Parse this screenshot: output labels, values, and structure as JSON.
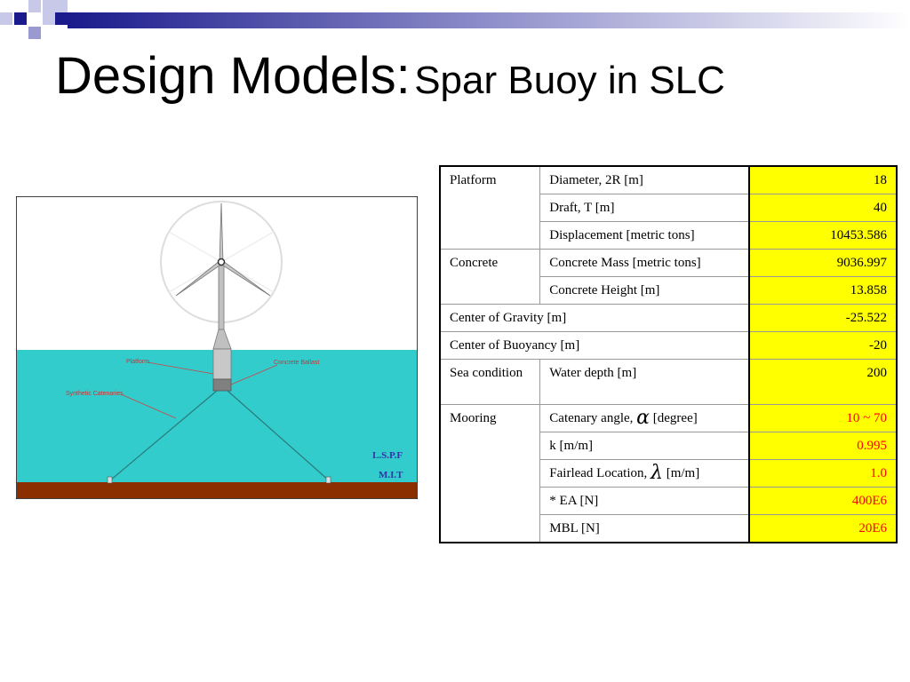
{
  "title": {
    "main": "Design Models:",
    "sub": "Spar Buoy in SLC"
  },
  "colors": {
    "value_highlight": "#ffff00",
    "mooring_value_text": "#ff0000",
    "sea": "#33cccc",
    "seabed": "#8b2e00"
  },
  "diagram": {
    "labels": {
      "platform": "Platform",
      "concrete_ballast": "Concrete Ballast",
      "synthetic_catenaries": "Synthetic Catenaries",
      "lab": "L.S.P.F",
      "institute": "M.I.T"
    }
  },
  "table": {
    "rows": [
      {
        "group": "Platform",
        "param": "Diameter, 2R [m]",
        "value": "18"
      },
      {
        "param": "Draft, T [m]",
        "value": "40"
      },
      {
        "param": "Displacement [metric tons]",
        "value": "10453.586"
      },
      {
        "group": "Concrete",
        "param": "Concrete Mass [metric tons]",
        "value": "9036.997"
      },
      {
        "param": "Concrete Height [m]",
        "value": "13.858"
      },
      {
        "param": "Center of Gravity [m]",
        "value": "-25.522"
      },
      {
        "param": "Center of Buoyancy [m]",
        "value": "-20"
      },
      {
        "group": "Sea condition",
        "param": "Water depth [m]",
        "value": "200"
      },
      {
        "group": "Mooring",
        "param_prefix": "Catenary angle,",
        "symbol": "α",
        "param_suffix": "[degree]",
        "value": "10 ~ 70"
      },
      {
        "param": "k [m/m]",
        "value": "0.995"
      },
      {
        "param_prefix": "Fairlead Location,",
        "symbol": "λ",
        "param_suffix": "[m/m]",
        "value": "1.0"
      },
      {
        "param": "* EA [N]",
        "value": "400E6"
      },
      {
        "param": "MBL [N]",
        "value": "20E6"
      }
    ]
  }
}
